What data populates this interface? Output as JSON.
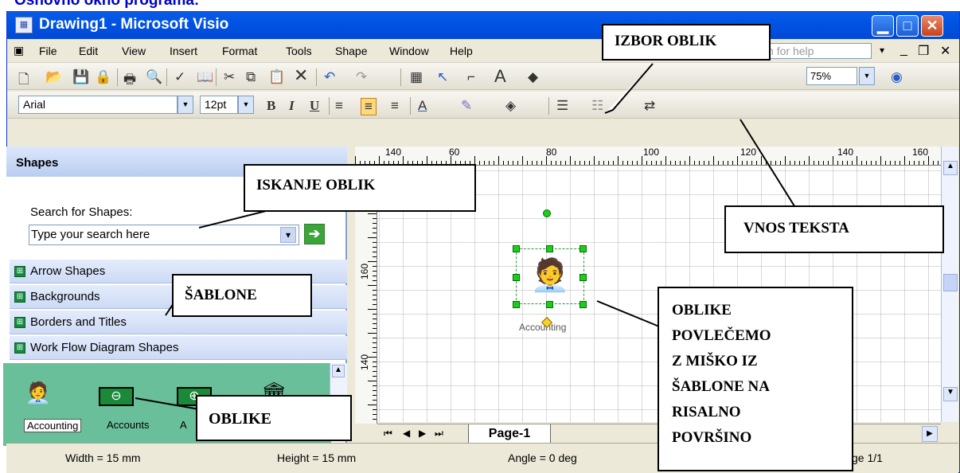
{
  "caption": "Osnovno okno programa:",
  "window": {
    "title": "Drawing1 - Microsoft Visio",
    "icon_name": "visio-app-icon",
    "buttons": {
      "min": "minimize-icon",
      "max": "maximize-icon",
      "close": "close-icon"
    }
  },
  "menu": [
    "File",
    "Edit",
    "View",
    "Insert",
    "Format",
    "Tools",
    "Shape",
    "Window",
    "Help"
  ],
  "help_search": "Type a question for help",
  "toolbar": {
    "zoom": "75%"
  },
  "format": {
    "font": "Arial",
    "size": "12pt"
  },
  "shapes_panel": {
    "title": "Shapes",
    "search_label": "Search for Shapes:",
    "search_placeholder": "Type your search here",
    "stencils": [
      "Arrow Shapes",
      "Backgrounds",
      "Borders and Titles",
      "Work Flow Diagram Shapes"
    ],
    "items": [
      "Accounting",
      "Accounts",
      "A"
    ]
  },
  "ruler": {
    "h": [
      "140",
      "60",
      "80",
      "100",
      "120",
      "140",
      "160"
    ],
    "v": [
      "160",
      "140"
    ]
  },
  "canvas_shape_label": "Accounting",
  "page_tab": "Page-1",
  "status": {
    "width": "Width = 15 mm",
    "height": "Height = 15 mm",
    "angle": "Angle = 0 deg",
    "page": "ge 1/1"
  },
  "callouts": {
    "izbor": "IZBOR OBLIK",
    "iskanje": "ISKANJE  OBLIK",
    "vnos": "VNOS TEKSTA",
    "sablone": "ŠABLONE",
    "oblike": "OBLIKE",
    "povlecemo": [
      "OBLIKE",
      "POVLEČEMO",
      "Z MIŠKO  IZ",
      "ŠABLONE NA",
      "RISALNO",
      "POVRŠINO"
    ]
  },
  "colors": {
    "titlebar": "#0054e3",
    "canvas_grid": "#c8c8c8",
    "stencil_bg": "#69bf9a",
    "selection": "#19d019"
  }
}
